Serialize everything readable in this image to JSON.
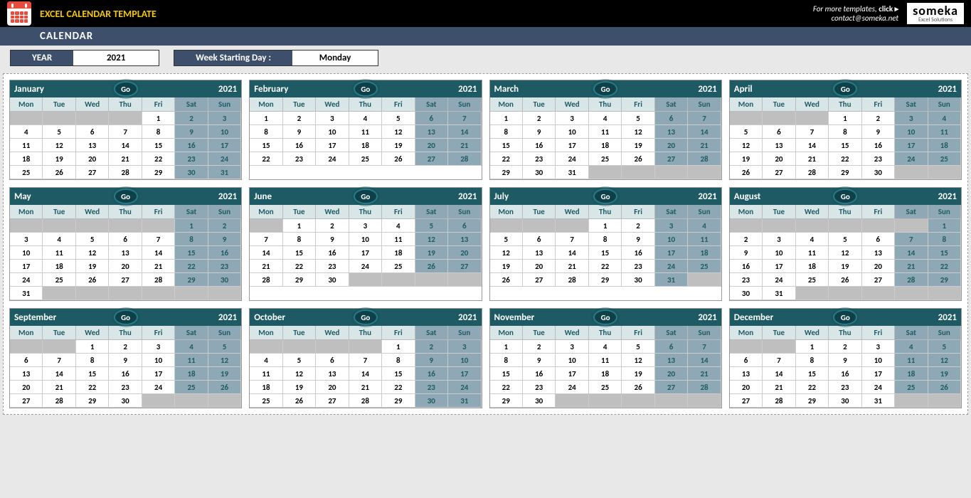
{
  "header": {
    "template_title": "EXCEL CALENDAR TEMPLATE",
    "subtitle": "CALENDAR",
    "more_text": "For more templates, ",
    "more_bold": "click ▸",
    "contact": "contact@someka.net",
    "logo_big": "someka",
    "logo_small": "Excel Solutions"
  },
  "controls": {
    "year_label": "YEAR",
    "year_value": "2021",
    "wsd_label": "Week Starting Day :",
    "wsd_value": "Monday"
  },
  "day_headers": [
    "Mon",
    "Tue",
    "Wed",
    "Thu",
    "Fri",
    "Sat",
    "Sun"
  ],
  "go_label": "Go",
  "year": "2021",
  "months": [
    {
      "name": "January",
      "offset": 4,
      "days": 31
    },
    {
      "name": "February",
      "offset": 0,
      "days": 28
    },
    {
      "name": "March",
      "offset": 0,
      "days": 31
    },
    {
      "name": "April",
      "offset": 3,
      "days": 30
    },
    {
      "name": "May",
      "offset": 5,
      "days": 31
    },
    {
      "name": "June",
      "offset": 1,
      "days": 30
    },
    {
      "name": "July",
      "offset": 3,
      "days": 31
    },
    {
      "name": "August",
      "offset": 6,
      "days": 31
    },
    {
      "name": "September",
      "offset": 2,
      "days": 30
    },
    {
      "name": "October",
      "offset": 4,
      "days": 31
    },
    {
      "name": "November",
      "offset": 0,
      "days": 30
    },
    {
      "name": "December",
      "offset": 2,
      "days": 31
    }
  ]
}
